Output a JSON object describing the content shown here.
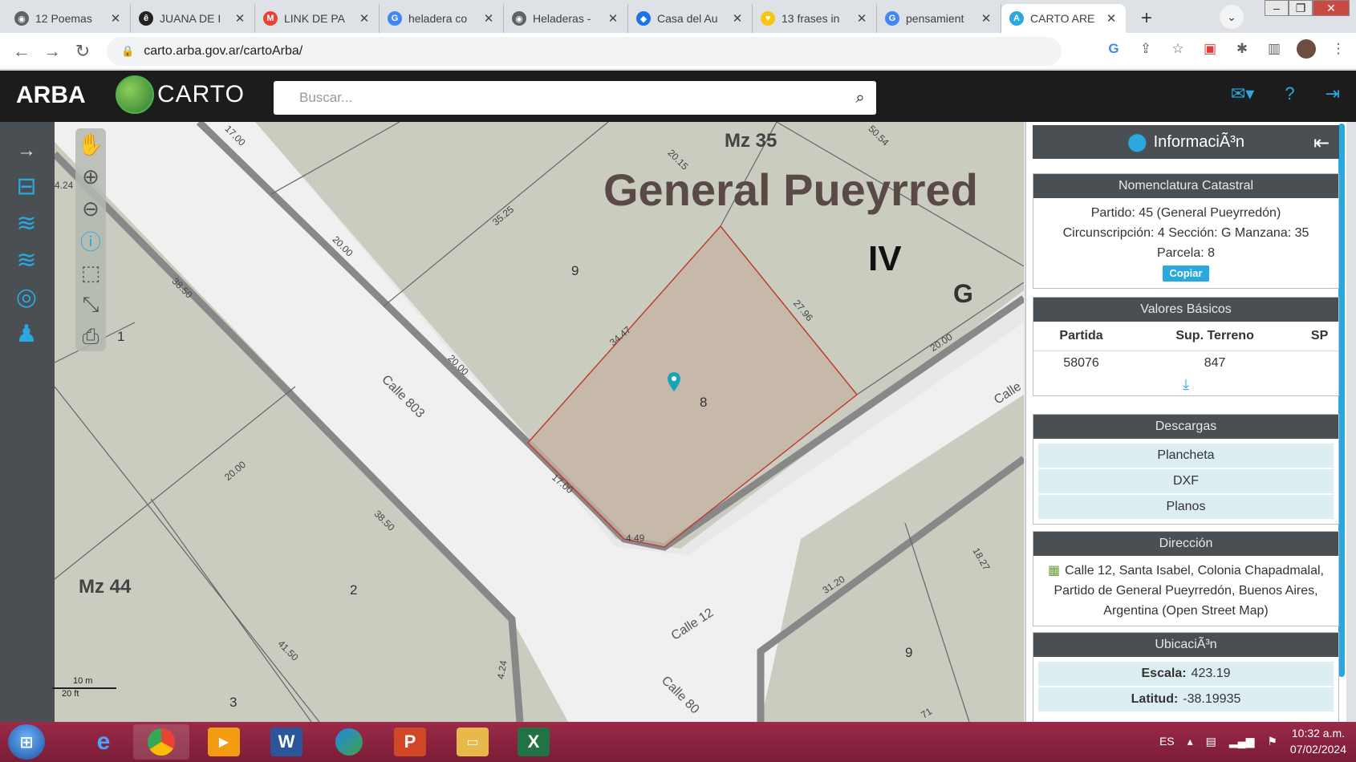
{
  "browser": {
    "tabs": [
      {
        "title": "12 Poemas",
        "fav_color": "#5f6368",
        "fav_text": "◉"
      },
      {
        "title": "JUANA DE I",
        "fav_color": "#222222",
        "fav_text": "ê"
      },
      {
        "title": "LINK DE PA",
        "fav_color": "#ea4335",
        "fav_text": "M"
      },
      {
        "title": "heladera co",
        "fav_color": "#4285f4",
        "fav_text": "G"
      },
      {
        "title": "Heladeras -",
        "fav_color": "#5f6368",
        "fav_text": "◉"
      },
      {
        "title": "Casa del Au",
        "fav_color": "#1a73e8",
        "fav_text": "◆"
      },
      {
        "title": "13 frases in",
        "fav_color": "#f9c512",
        "fav_text": "♥"
      },
      {
        "title": "pensamient",
        "fav_color": "#4285f4",
        "fav_text": "G"
      },
      {
        "title": "CARTO ARE",
        "fav_color": "#2aa8e0",
        "fav_text": "A",
        "active": true
      }
    ],
    "url": "carto.arba.gov.ar/cartoArba/"
  },
  "app": {
    "brand": "ARBA",
    "carto_label": "CARTO",
    "search_placeholder": "Buscar..."
  },
  "map": {
    "labels": {
      "mz35": "Mz 35",
      "partido": "General Pueyrred",
      "circ": "IV",
      "seccion": "G",
      "mz44": "Mz 44",
      "p9a": "9",
      "p8": "8",
      "p2": "2",
      "p1": "1",
      "p3": "3",
      "p9b": "9",
      "calle803": "Calle 803",
      "calle12": "Calle 12",
      "calle80x": "Calle 80",
      "calleR": "Calle"
    },
    "dims": {
      "d1": "17.00",
      "d2": "20.15",
      "d3": "50.54",
      "d4": "35.25",
      "d5": "20.00",
      "d6": "38.50",
      "d7": "34.47",
      "d8": "27.96",
      "d9": "20.00",
      "d10": "20.00",
      "d11": "17.00",
      "d12": "4.49",
      "d13": "20.00",
      "d14": "38.50",
      "d15": "41.50",
      "d16": "4.24",
      "d17": "31.20",
      "d18": "18.27",
      "d19": "4.24",
      "d20": "41.50",
      "d21": "71"
    },
    "scale": {
      "m": "10 m",
      "ft": "20 ft"
    }
  },
  "panel": {
    "title": "InformaciÃ³n",
    "nomenclatura": {
      "header": "Nomenclatura Catastral",
      "line1": "Partido: 45 (General Pueyrredón)",
      "line2": "Circunscripción: 4 Sección: G Manzana: 35",
      "line3": "Parcela: 8",
      "copy": "Copiar"
    },
    "valores": {
      "header": "Valores Básicos",
      "col1": "Partida",
      "col2": "Sup. Terreno",
      "col3": "SP",
      "partida": "58076",
      "sup": "847",
      "sp": ""
    },
    "descargas": {
      "header": "Descargas",
      "items": [
        "Plancheta",
        "DXF",
        "Planos"
      ]
    },
    "direccion": {
      "header": "Dirección",
      "text": "Calle 12, Santa Isabel, Colonia Chapadmalal, Partido de General Pueyrredón, Buenos Aires, Argentina (Open Street Map)"
    },
    "ubicacion": {
      "header": "UbicaciÃ³n",
      "escala_k": "Escala:",
      "escala_v": "423.19",
      "lat_k": "Latitud:",
      "lat_v": "-38.19935"
    }
  },
  "taskbar": {
    "lang": "ES",
    "time": "10:32 a.m.",
    "date": "07/02/2024"
  }
}
